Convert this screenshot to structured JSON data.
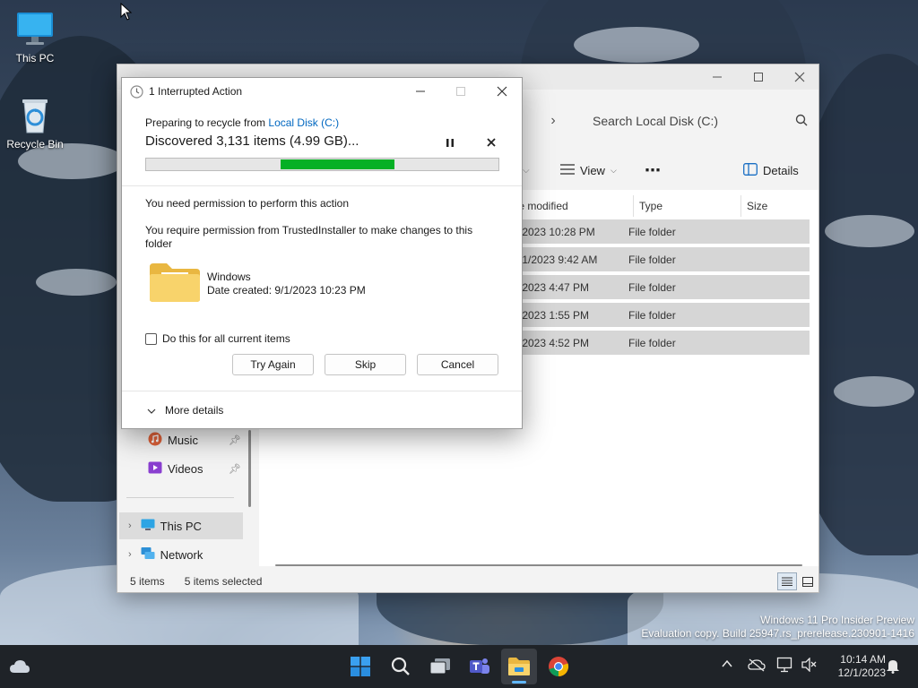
{
  "desktop": {
    "icons": [
      {
        "label": "This PC"
      },
      {
        "label": "Recycle Bin"
      }
    ],
    "watermark": {
      "line1": "Windows 11 Pro Insider Preview",
      "line2": "Evaluation copy. Build 25947.rs_prerelease.230901-1416"
    }
  },
  "explorer": {
    "search_placeholder": "Search Local Disk (C:)",
    "breadcrumb_chevron": "›",
    "toolbar": {
      "view_label": "View",
      "more_label": "⋯",
      "details_label": "Details"
    },
    "columns": {
      "modified": "te modified",
      "type": "Type",
      "size": "Size"
    },
    "rows": [
      {
        "date": "/2023 10:28 PM",
        "type": "File folder"
      },
      {
        "date": "/1/2023 9:42 AM",
        "type": "File folder"
      },
      {
        "date": "/2023 4:47 PM",
        "type": "File folder"
      },
      {
        "date": "/2023 1:55 PM",
        "type": "File folder"
      },
      {
        "date": "/2023 4:52 PM",
        "type": "File folder"
      }
    ],
    "nav": {
      "music": "Music",
      "videos": "Videos",
      "this_pc": "This PC",
      "network": "Network"
    },
    "status": {
      "items": "5 items",
      "selected": "5 items selected"
    }
  },
  "dialog": {
    "title": "1 Interrupted Action",
    "preparing_prefix": "Preparing to recycle from ",
    "preparing_link": "Local Disk (C:)",
    "discovered": "Discovered 3,131 items (4.99 GB)...",
    "progress": 0.75,
    "permission_heading": "You need permission to perform this action",
    "permission_detail": "You require permission from TrustedInstaller to make changes to this folder",
    "item": {
      "name": "Windows",
      "date_created": "Date created: 9/1/2023 10:23 PM"
    },
    "checkbox_label": "Do this for all current items",
    "checkbox_checked": false,
    "buttons": {
      "try_again": "Try Again",
      "skip": "Skip",
      "cancel": "Cancel"
    },
    "more_details": "More details"
  },
  "taskbar": {
    "clock_time": "10:14 AM",
    "clock_date": "12/1/2023",
    "apps": [
      "start-icon",
      "search-icon",
      "task-view-icon",
      "teams-icon",
      "file-explorer-icon",
      "chrome-icon"
    ]
  },
  "colors": {
    "progress_green": "#06b025",
    "link_blue": "#0067c0",
    "taskbar": "#1f2328"
  }
}
